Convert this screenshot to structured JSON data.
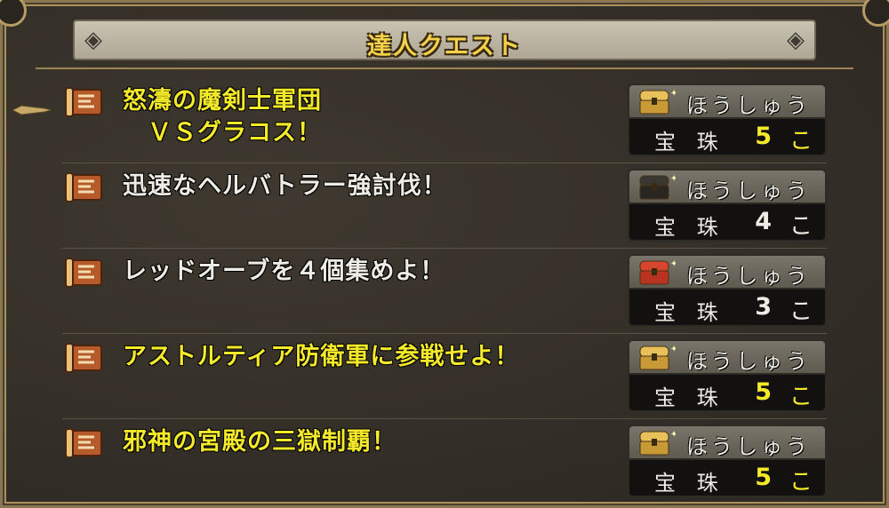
{
  "window": {
    "title": "達人クエスト"
  },
  "colors": {
    "highlight": "#f5ea2a",
    "normal_text": "#ecebe4",
    "title_text": "#f4d14a"
  },
  "quests": [
    {
      "name": "怒濤の魔剣士軍団\n　ＶＳグラコス！",
      "highlight": true,
      "reward_label": "ほうしゅう",
      "chest": "gold-chest-icon",
      "item": "宝 珠",
      "count": "5",
      "unit": "こ"
    },
    {
      "name": "迅速なヘルバトラー強討伐！",
      "highlight": false,
      "reward_label": "ほうしゅう",
      "chest": "dark-chest-icon",
      "item": "宝 珠",
      "count": "4",
      "unit": "こ"
    },
    {
      "name": "レッドオーブを４個集めよ！",
      "highlight": false,
      "reward_label": "ほうしゅう",
      "chest": "red-chest-icon",
      "item": "宝 珠",
      "count": "3",
      "unit": "こ"
    },
    {
      "name": "アストルティア防衛軍に参戦せよ！",
      "highlight": true,
      "reward_label": "ほうしゅう",
      "chest": "gold-chest-icon",
      "item": "宝 珠",
      "count": "5",
      "unit": "こ"
    },
    {
      "name": "邪神の宮殿の三獄制覇！",
      "highlight": true,
      "reward_label": "ほうしゅう",
      "chest": "gold-chest-icon",
      "item": "宝 珠",
      "count": "5",
      "unit": "こ"
    }
  ]
}
